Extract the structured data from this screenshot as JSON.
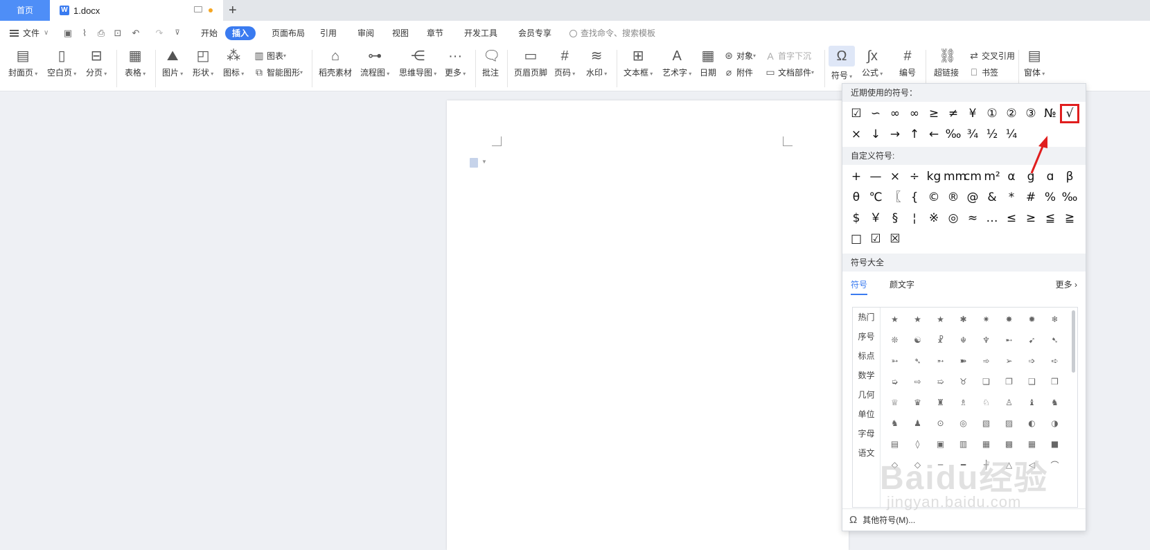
{
  "tabbar": {
    "home": "首页",
    "doc_title": "1.docx",
    "new_tab": "+"
  },
  "menu": {
    "file": "文件",
    "tabs": [
      "开始",
      "插入",
      "页面布局",
      "引用",
      "审阅",
      "视图",
      "章节",
      "开发工具",
      "会员专享"
    ],
    "active_tab": "插入",
    "search_placeholder": "查找命令、搜索模板"
  },
  "ribbon": {
    "cover": "封面页",
    "blank": "空白页",
    "pagebreak": "分页",
    "table": "表格",
    "picture": "图片",
    "shape": "形状",
    "icon": "图标",
    "chart": "图表",
    "smartart": "智能图形",
    "daoke": "稻壳素材",
    "flow": "流程图",
    "mindmap": "思维导图",
    "more": "更多",
    "comment": "批注",
    "headerfooter": "页眉页脚",
    "pagenum": "页码",
    "watermark": "水印",
    "textbox": "文本框",
    "wordart": "艺术字",
    "date": "日期",
    "object": "对象",
    "attachment": "附件",
    "dropcap": "首字下沉",
    "docpart": "文档部件",
    "symbol": "符号",
    "formula": "公式",
    "numbering": "编号",
    "hyperlink": "超链接",
    "crossref": "交叉引用",
    "bookmark": "书签",
    "window": "窗体"
  },
  "dropdown": {
    "recent_header": "近期使用的符号：",
    "recent_row1": [
      "☑",
      "∽",
      "∞",
      "∞",
      "≥",
      "≠",
      "¥",
      "①",
      "②",
      "③",
      "№",
      "√"
    ],
    "recent_row2": [
      "×",
      "↓",
      "→",
      "↑",
      "←",
      "‰",
      "¾",
      "½",
      "¼"
    ],
    "custom_header": "自定义符号:",
    "custom_rows": [
      [
        "+",
        "—",
        "×",
        "÷",
        "kg",
        "mm",
        "cm",
        "m²",
        "α",
        "g",
        "ɑ",
        "β"
      ],
      [
        "θ",
        "℃",
        "〖",
        "{",
        "©",
        "®",
        "@",
        "&",
        "*",
        "#",
        "%",
        "‰"
      ],
      [
        "$",
        "￥",
        "§",
        "¦",
        "※",
        "◎",
        "≈",
        "…",
        "≤",
        "≥",
        "≦",
        "≧"
      ],
      [
        "□",
        "☑",
        "☒"
      ]
    ],
    "all_header": "符号大全",
    "tab_symbols": "符号",
    "tab_kaomoji": "颜文字",
    "more": "更多",
    "categories": [
      "热门",
      "序号",
      "标点",
      "数学",
      "几何",
      "单位",
      "字母",
      "语文"
    ],
    "glyph_rows": [
      [
        "★",
        "★",
        "★",
        "✱",
        "✷",
        "✸",
        "✹",
        "❄"
      ],
      [
        "❊",
        "☯",
        "☧",
        "☬",
        "♆",
        "➸",
        "➹",
        "➷"
      ],
      [
        "➳",
        "➴",
        "➵",
        "➽",
        "➾",
        "➢",
        "➩",
        "➪"
      ],
      [
        "➭",
        "⇨",
        "➯",
        "♉",
        "❏",
        "❐",
        "❑",
        "❒"
      ],
      [
        "♕",
        "♛",
        "♜",
        "♗",
        "♘",
        "♙",
        "♝",
        "♞"
      ],
      [
        "♞",
        "♟",
        "⊙",
        "◎",
        "▧",
        "▨",
        "◐",
        "◑"
      ],
      [
        "▤",
        "◊",
        "▣",
        "▥",
        "▦",
        "▩",
        "▦",
        "■"
      ],
      [
        "◇",
        "◇",
        "─",
        "━",
        "┼",
        "△",
        "◁",
        "⌒"
      ]
    ],
    "other_symbols": "其他符号(M)..."
  },
  "watermark": {
    "main": "Baidu经验",
    "sub": "jingyan.baidu.com"
  },
  "colors": {
    "accent": "#3a7bf0",
    "highlight": "#e01e1e"
  }
}
